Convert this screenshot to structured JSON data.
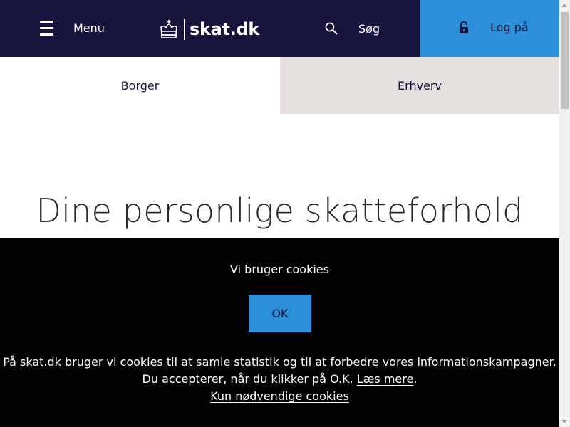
{
  "header": {
    "menu_label": "Menu",
    "logo_text": "skat.dk",
    "search_label": "Søg",
    "login_label": "Log på",
    "colors": {
      "header_bg": "#14143c",
      "login_bg": "#2a8fd8"
    }
  },
  "tabs": [
    {
      "label": "Borger",
      "active": true
    },
    {
      "label": "Erhverv",
      "active": false
    }
  ],
  "main": {
    "title": "Dine personlige skatteforhold"
  },
  "cookie_banner": {
    "title": "Vi bruger cookies",
    "ok_label": "OK",
    "text_line1": "På skat.dk bruger vi cookies til at samle statistik og til at forbedre vores informationskampagner.",
    "text_line2_prefix": "Du accepterer, når du klikker på O.K. ",
    "read_more_link": "Læs mere",
    "text_line2_suffix": ".",
    "necessary_only_link": "Kun nødvendige cookies"
  },
  "icons": [
    "hamburger-icon",
    "crown-icon",
    "search-icon",
    "lock-icon"
  ]
}
